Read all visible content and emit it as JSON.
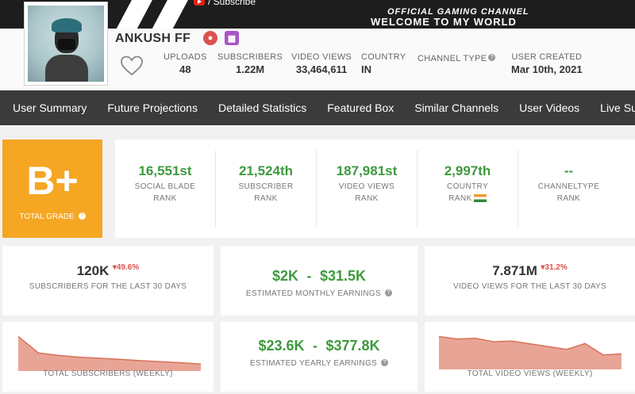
{
  "banner": {
    "subscribe_text": "/ Subscribe",
    "official_text": "OFFICIAL GAMING CHANNEL",
    "welcome_text": "WELCOME TO MY WORLD"
  },
  "channel": {
    "name": "ANKUSH FF",
    "stats": [
      {
        "label": "UPLOADS",
        "value": "48"
      },
      {
        "label": "SUBSCRIBERS",
        "value": "1.22M"
      },
      {
        "label": "VIDEO VIEWS",
        "value": "33,464,611"
      },
      {
        "label": "COUNTRY",
        "value": "IN"
      },
      {
        "label": "CHANNEL TYPE",
        "value": ""
      },
      {
        "label": "USER CREATED",
        "value": "Mar 10th, 2021"
      }
    ]
  },
  "nav": {
    "items": [
      "User Summary",
      "Future Projections",
      "Detailed Statistics",
      "Featured Box",
      "Similar Channels",
      "User Videos",
      "Live Subscriber"
    ]
  },
  "grade": {
    "letter": "B+",
    "label": "TOTAL GRADE"
  },
  "ranks": [
    {
      "value": "16,551st",
      "l1": "SOCIAL BLADE",
      "l2": "RANK"
    },
    {
      "value": "21,524th",
      "l1": "SUBSCRIBER",
      "l2": "RANK"
    },
    {
      "value": "187,981st",
      "l1": "VIDEO VIEWS",
      "l2": "RANK"
    },
    {
      "value": "2,997th",
      "l1": "COUNTRY",
      "l2": "RANK"
    },
    {
      "value": "--",
      "l1": "CHANNELTYPE",
      "l2": "RANK"
    }
  ],
  "summary": {
    "subs30": {
      "value": "120K",
      "change": "49.6%",
      "label": "SUBSCRIBERS FOR THE LAST 30 DAYS"
    },
    "monthly": {
      "low": "$2K",
      "sep": "-",
      "high": "$31.5K",
      "label": "ESTIMATED MONTHLY EARNINGS"
    },
    "views30": {
      "value": "7.871M",
      "change": "31.2%",
      "label": "VIDEO VIEWS FOR THE LAST 30 DAYS"
    },
    "yearly": {
      "low": "$23.6K",
      "sep": "-",
      "high": "$377.8K",
      "label": "ESTIMATED YEARLY EARNINGS"
    }
  },
  "charts": {
    "subs_label": "TOTAL SUBSCRIBERS (WEEKLY)",
    "views_label": "TOTAL VIDEO VIEWS (WEEKLY)",
    "color": "#d9705b",
    "fill": "#e8a596"
  },
  "colors": {
    "grade": "#f5a623",
    "rank": "#3d9a3d",
    "nav": "#3b3b3b",
    "negative": "#d9534f"
  },
  "chart_data": [
    {
      "type": "area",
      "title": "TOTAL SUBSCRIBERS (WEEKLY)",
      "x": [
        1,
        2,
        3,
        4,
        5,
        6,
        7,
        8,
        9,
        10
      ],
      "values": [
        100,
        52,
        45,
        40,
        37,
        34,
        30,
        27,
        24,
        20
      ],
      "ylim": [
        0,
        110
      ]
    },
    {
      "type": "area",
      "title": "TOTAL VIDEO VIEWS (WEEKLY)",
      "x": [
        1,
        2,
        3,
        4,
        5,
        6,
        7,
        8,
        9,
        10,
        11
      ],
      "values": [
        95,
        88,
        90,
        80,
        82,
        74,
        66,
        58,
        75,
        42,
        45
      ],
      "ylim": [
        0,
        110
      ]
    }
  ]
}
